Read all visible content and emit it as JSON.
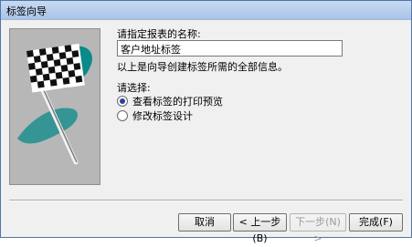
{
  "window": {
    "title": "标签向导"
  },
  "step": {
    "prompt_name": "请指定报表的名称:",
    "report_name_value": "客户地址标签",
    "info_text": "以上是向导创建标签所需的全部信息。",
    "choose_label": "请选择:",
    "options": [
      {
        "label": "查看标签的打印预览",
        "selected": true
      },
      {
        "label": "修改标签设计",
        "selected": false
      }
    ]
  },
  "buttons": {
    "cancel": "取消",
    "back": "< 上一步(B)",
    "next": "下一步(N) >",
    "finish": "完成(F)"
  },
  "colors": {
    "title_bar": "#b3cbeb",
    "illustration_bg": "#b7b7b7",
    "flag_accent": "#0a8a89",
    "radio_selected": "#2a3fa3"
  },
  "icons": {
    "illustration": "checkered-flag-illustration-icon"
  }
}
